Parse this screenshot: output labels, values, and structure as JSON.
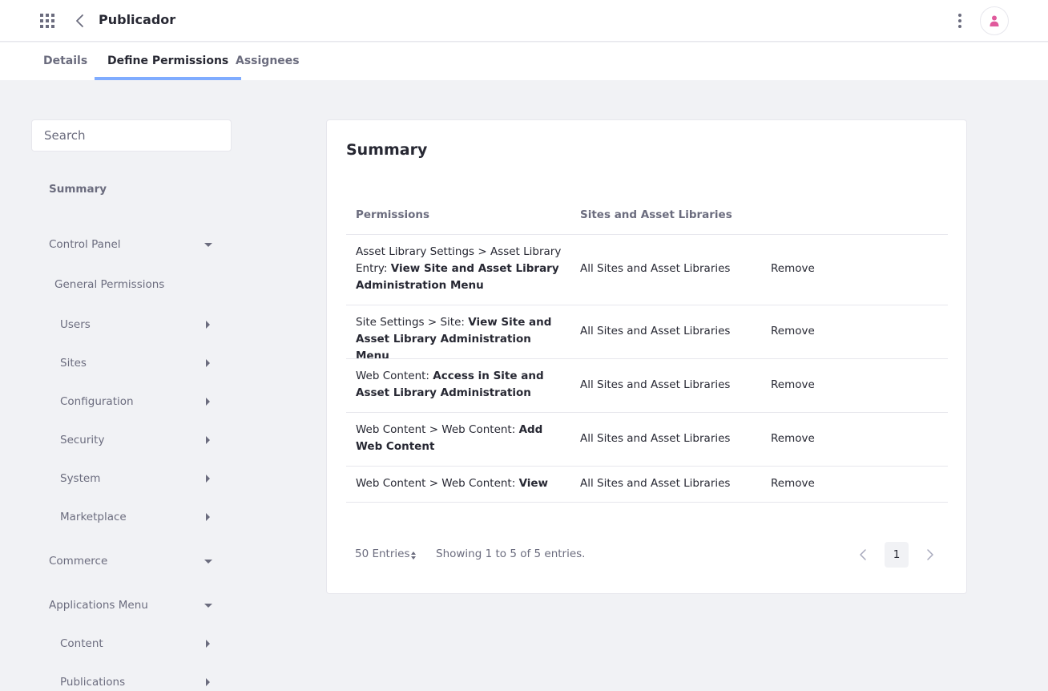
{
  "header": {
    "title": "Publicador",
    "apps_icon": "apps-grid-icon",
    "back_icon": "chevron-left-icon",
    "options_icon": "kebab-vertical-icon",
    "avatar_icon": "user-icon"
  },
  "tabs": [
    {
      "label": "Details",
      "active": false
    },
    {
      "label": "Define Permissions",
      "active": true
    },
    {
      "label": "Assignees",
      "active": false
    }
  ],
  "sidebar": {
    "search_placeholder": "Search",
    "summary": "Summary",
    "control_panel": "Control Panel",
    "general_permissions": "General Permissions",
    "users": "Users",
    "sites": "Sites",
    "configuration": "Configuration",
    "security": "Security",
    "system": "System",
    "marketplace": "Marketplace",
    "commerce": "Commerce",
    "applications_menu": "Applications Menu",
    "content": "Content",
    "publications": "Publications"
  },
  "summary": {
    "title": "Summary",
    "columns": {
      "permissions": "Permissions",
      "sites": "Sites and Asset Libraries"
    },
    "rows": [
      {
        "prefix": "Asset Library Settings > Asset Library Entry: ",
        "action": "View Site and Asset Library Administration Menu",
        "scope": "All Sites and Asset Libraries",
        "remove": "Remove"
      },
      {
        "prefix": "Site Settings > Site: ",
        "action": "View Site and Asset Library Administration Menu",
        "scope": "All Sites and Asset Libraries",
        "remove": "Remove"
      },
      {
        "prefix": "Web Content: ",
        "action": "Access in Site and Asset Library Administration",
        "scope": "All Sites and Asset Libraries",
        "remove": "Remove"
      },
      {
        "prefix": "Web Content > Web Content: ",
        "action": "Add Web Content",
        "scope": "All Sites and Asset Libraries",
        "remove": "Remove"
      },
      {
        "prefix": "Web Content > Web Content: ",
        "action": "View",
        "scope": "All Sites and Asset Libraries",
        "remove": "Remove"
      }
    ]
  },
  "pagination": {
    "entries": "50 Entries",
    "showing": "Showing 1 to 5 of 5 entries.",
    "current_page": "1"
  },
  "colors": {
    "accent": "#80acff",
    "avatar_pink": "#e05a9c",
    "text_secondary": "#6b6c7e",
    "text_primary": "#272833",
    "background": "#f1f2f5"
  }
}
